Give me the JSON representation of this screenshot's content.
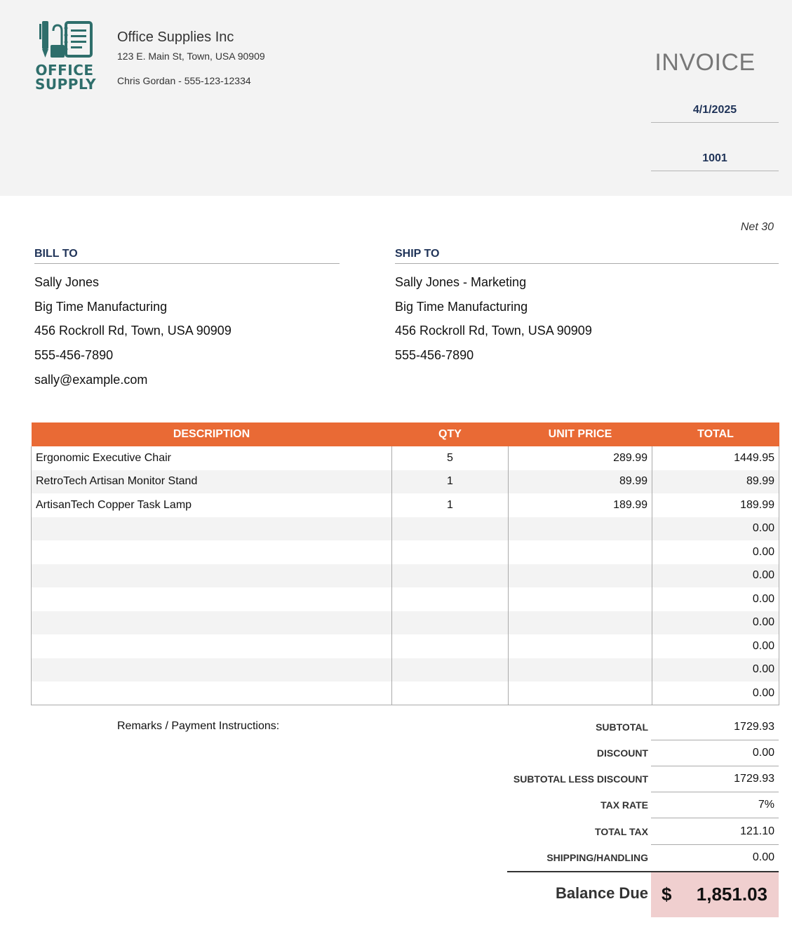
{
  "header": {
    "logo_text_line1": "OFFICE",
    "logo_text_line2": "SUPPLY",
    "company_name": "Office Supplies Inc",
    "company_address": "123 E. Main St, Town, USA 90909",
    "company_contact": "Chris Gordan - 555-123-12334",
    "title": "INVOICE",
    "date": "4/1/2025",
    "invoice_number": "1001"
  },
  "terms": "Net 30",
  "bill_to": {
    "heading": "BILL TO",
    "name": "Sally Jones",
    "company": "Big Time Manufacturing",
    "address": "456 Rockroll Rd, Town, USA 90909",
    "phone": "555-456-7890",
    "email": "sally@example.com"
  },
  "ship_to": {
    "heading": "SHIP TO",
    "name": "Sally Jones - Marketing",
    "company": "Big Time Manufacturing",
    "address": "456 Rockroll Rd, Town, USA 90909",
    "phone": "555-456-7890"
  },
  "items": {
    "headers": [
      "DESCRIPTION",
      "QTY",
      "UNIT PRICE",
      "TOTAL"
    ],
    "rows": [
      {
        "description": "Ergonomic Executive Chair",
        "qty": "5",
        "unit_price": "289.99",
        "total": "1449.95"
      },
      {
        "description": "RetroTech Artisan Monitor Stand",
        "qty": "1",
        "unit_price": "89.99",
        "total": "89.99"
      },
      {
        "description": "ArtisanTech Copper Task Lamp",
        "qty": "1",
        "unit_price": "189.99",
        "total": "189.99"
      },
      {
        "description": "",
        "qty": "",
        "unit_price": "",
        "total": "0.00"
      },
      {
        "description": "",
        "qty": "",
        "unit_price": "",
        "total": "0.00"
      },
      {
        "description": "",
        "qty": "",
        "unit_price": "",
        "total": "0.00"
      },
      {
        "description": "",
        "qty": "",
        "unit_price": "",
        "total": "0.00"
      },
      {
        "description": "",
        "qty": "",
        "unit_price": "",
        "total": "0.00"
      },
      {
        "description": "",
        "qty": "",
        "unit_price": "",
        "total": "0.00"
      },
      {
        "description": "",
        "qty": "",
        "unit_price": "",
        "total": "0.00"
      },
      {
        "description": "",
        "qty": "",
        "unit_price": "",
        "total": "0.00"
      }
    ]
  },
  "remarks_label": "Remarks / Payment Instructions:",
  "summary": [
    {
      "label": "SUBTOTAL",
      "value": "1729.93"
    },
    {
      "label": "DISCOUNT",
      "value": "0.00"
    },
    {
      "label": "SUBTOTAL LESS DISCOUNT",
      "value": "1729.93"
    },
    {
      "label": "TAX RATE",
      "value": "7%"
    },
    {
      "label": "TOTAL TAX",
      "value": "121.10"
    },
    {
      "label": "SHIPPING/HANDLING",
      "value": "0.00"
    }
  ],
  "balance": {
    "label": "Balance Due",
    "currency": "$",
    "amount": "1,851.03"
  },
  "colors": {
    "accent_orange": "#e96a35",
    "heading_navy": "#1f3358",
    "logo_teal": "#2e6e6b",
    "balance_bg": "#f0cfcf",
    "header_bg": "#f3f3f3"
  },
  "icons": {
    "logo": "office-supply-logo"
  }
}
